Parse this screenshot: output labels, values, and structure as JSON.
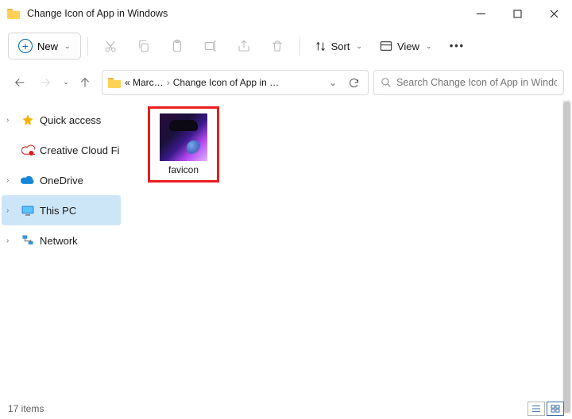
{
  "window": {
    "title": "Change Icon of App in Windows"
  },
  "toolbar": {
    "new_label": "New",
    "sort_label": "Sort",
    "view_label": "View"
  },
  "breadcrumbs": {
    "seg1": "« Marc…",
    "seg2": "Change Icon of App in …"
  },
  "search": {
    "placeholder": "Search Change Icon of App in Windows"
  },
  "sidebar": {
    "items": [
      {
        "label": "Quick access"
      },
      {
        "label": "Creative Cloud Fi"
      },
      {
        "label": "OneDrive"
      },
      {
        "label": "This PC"
      },
      {
        "label": "Network"
      }
    ]
  },
  "files": [
    {
      "name": "favicon"
    }
  ],
  "status": {
    "count_text": "17 items"
  }
}
